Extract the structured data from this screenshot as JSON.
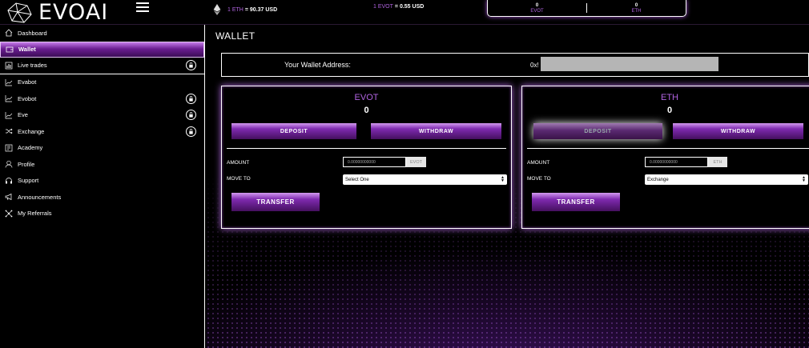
{
  "app": {
    "logo_text": "EVOAI"
  },
  "header": {
    "rate_eth_prefix": "1 ETH",
    "rate_eth_value": "= 90.37 USD",
    "rate_evot_prefix": "1 EVOT",
    "rate_evot_value": "= 0.55 USD",
    "balances": [
      {
        "value": "0",
        "label": "EVOT"
      },
      {
        "value": "0",
        "label": "ETH"
      }
    ]
  },
  "sidebar": {
    "items": [
      {
        "label": "Dashboard",
        "icon": "home-icon"
      },
      {
        "label": "Wallet",
        "icon": "wallet-icon"
      },
      {
        "label": "Live trades",
        "icon": "bar-chart-icon"
      },
      {
        "label": "Evabot",
        "icon": "line-chart-icon"
      },
      {
        "label": "Evobot",
        "icon": "line-chart-icon"
      },
      {
        "label": "Eve",
        "icon": "line-chart-icon"
      },
      {
        "label": "Exchange",
        "icon": "shuffle-icon"
      },
      {
        "label": "Academy",
        "icon": "academy-icon"
      },
      {
        "label": "Profile",
        "icon": "user-icon"
      },
      {
        "label": "Support",
        "icon": "headset-icon"
      },
      {
        "label": "Announcements",
        "icon": "megaphone-icon"
      },
      {
        "label": "My Referrals",
        "icon": "network-icon"
      }
    ]
  },
  "main": {
    "title": "WALLET",
    "address_label": "Your Wallet Address:",
    "address_prefix": "0x!",
    "panels": {
      "evot": {
        "title": "EVOT",
        "balance": "0",
        "deposit_label": "DEPOSIT",
        "withdraw_label": "WITHDRAW",
        "amount_label": "AMOUNT",
        "amount_placeholder": "0.00000000000",
        "unit": "EVOT",
        "move_to_label": "MOVE TO",
        "move_to_value": "Select One",
        "transfer_label": "TRANSFER"
      },
      "eth": {
        "title": "ETH",
        "balance": "0",
        "deposit_label": "DEPOSIT",
        "withdraw_label": "WITHDRAW",
        "amount_label": "AMOUNT",
        "amount_placeholder": "0.00000000000",
        "unit": "ETH",
        "move_to_label": "MOVE TO",
        "move_to_value": "Exchange",
        "transfer_label": "TRANSFER"
      }
    }
  },
  "colors": {
    "accent": "#b063e0",
    "active_nav": "#6a1d91",
    "background": "#000000"
  }
}
